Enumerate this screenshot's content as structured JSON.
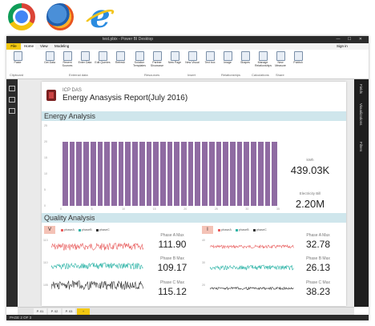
{
  "browsers": [
    "chrome-icon",
    "firefox-icon",
    "internet-explorer-icon"
  ],
  "window": {
    "title": "test.pbix - Power BI Desktop",
    "controls": "— ☐ ✕"
  },
  "ribbon": {
    "tabs": [
      "File",
      "Home",
      "View",
      "Modeling"
    ],
    "sign_in": "Sign in",
    "buttons": [
      "Paste",
      "Get Data",
      "Recent Sources",
      "Enter Data",
      "Edit Queries",
      "Refresh",
      "Solution Templates",
      "Partner Showcase",
      "New Page",
      "New Visual",
      "Text box",
      "Image",
      "Shapes",
      "Manage Relationships",
      "New Measure",
      "Publish"
    ],
    "groups": [
      "Clipboard",
      "External data",
      "Resources",
      "Insert",
      "Relationships",
      "Calculations",
      "Share"
    ]
  },
  "right_panes": [
    "Fields",
    "Visualizations",
    "Filters"
  ],
  "report": {
    "company": "ICP DAS",
    "title": "Energy Anasysis Report(July 2016)",
    "energy_section": "Energy Analysis",
    "quality_section": "Quality Analysis"
  },
  "kpis": [
    {
      "label": "kWh",
      "value": "439.03K"
    },
    {
      "label": "Electricity Bill",
      "value": "2.20M"
    }
  ],
  "quality_panels": [
    {
      "header": "V",
      "legend": [
        "phaseA",
        "phaseB",
        "phaseC"
      ],
      "yticks": [
        "113",
        "110",
        "105"
      ],
      "phases": [
        {
          "label": "Phase A Max",
          "value": "111.90"
        },
        {
          "label": "Phase B Max",
          "value": "109.17"
        },
        {
          "label": "Phase C Max",
          "value": "115.12"
        }
      ]
    },
    {
      "header": "I",
      "legend": [
        "phaseA",
        "phaseB",
        "phaseC"
      ],
      "yticks": [
        "40",
        "30",
        "20"
      ],
      "phases": [
        {
          "label": "Phase A Max",
          "value": "32.78"
        },
        {
          "label": "Phase B Max",
          "value": "26.13"
        },
        {
          "label": "Phase C Max",
          "value": "38.23"
        }
      ]
    }
  ],
  "chart_data": {
    "type": "bar",
    "title": "Energy Analysis",
    "categories": [
      "1",
      "2",
      "3",
      "4",
      "5",
      "6",
      "7",
      "8",
      "9",
      "10",
      "11",
      "12",
      "13",
      "14",
      "15",
      "16",
      "17",
      "18",
      "19",
      "20",
      "21",
      "22",
      "23",
      "24",
      "25",
      "26",
      "27",
      "28",
      "29",
      "30",
      "31"
    ],
    "values": [
      20,
      20,
      20,
      20,
      20,
      20,
      20,
      20,
      20,
      20,
      20,
      20,
      20,
      20,
      20,
      20,
      20,
      20,
      20,
      20,
      20,
      20,
      20,
      20,
      20,
      20,
      20,
      20,
      20,
      20,
      20
    ],
    "yticks": [
      "25",
      "20",
      "15",
      "10",
      "5",
      "0"
    ],
    "xticks": [
      "0",
      "5",
      "10",
      "15",
      "20",
      "25",
      "30",
      "35"
    ],
    "ylim": [
      0,
      25
    ],
    "color": "#8f6ba2"
  },
  "page_tabs": [
    "P. 01",
    "P. 02",
    "P. 03",
    "+"
  ],
  "status": "PAGE 2 OF 3",
  "colors": {
    "accent": "#f2c811",
    "section_bar": "#cfe6ec",
    "phase_a": "#e85d5d",
    "phase_b": "#2bb3a6",
    "phase_c": "#333333"
  }
}
